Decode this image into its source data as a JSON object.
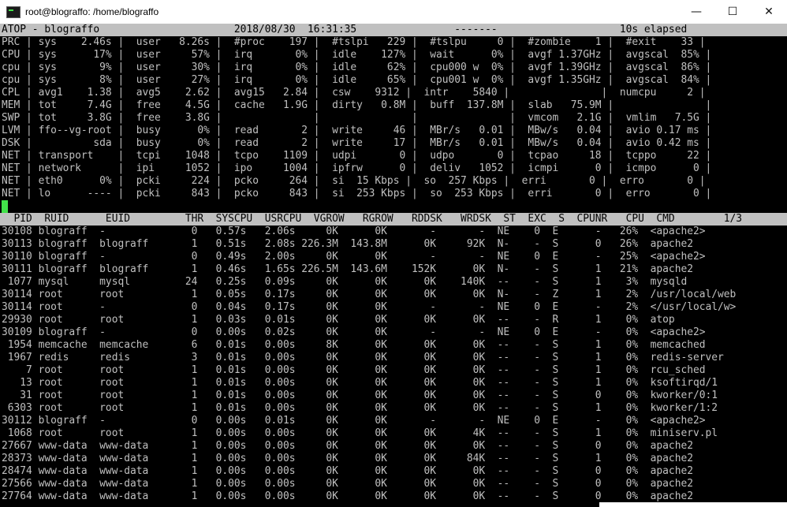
{
  "window": {
    "title": "root@blograffo: /home/blograffo",
    "minimize": "—",
    "maximize": "☐",
    "close": "✕"
  },
  "atop_header": "ATOP - blograffo                      2018/08/30  16:31:35                -------                    10s elapsed",
  "system_lines": [
    "PRC | sys    2.46s |  user   8.26s |  #proc    197 |  #tslpi   229 |  #tslpu     0 |  #zombie    1 |  #exit    33 |",
    "CPU | sys      17% |  user     57% |  irq       0% |  idle    127% |  wait      0% |  avgf 1.37GHz |  avgscal  85% |",
    "cpu | sys       9% |  user     30% |  irq       0% |  idle     62% |  cpu000 w  0% |  avgf 1.39GHz |  avgscal  86% |",
    "cpu | sys       8% |  user     27% |  irq       0% |  idle     65% |  cpu001 w  0% |  avgf 1.35GHz |  avgscal  84% |",
    "CPL | avg1    1.38 |  avg5    2.62 |  avg15   2.84 |  csw    9312 |  intr    5840 |               |  numcpu     2 |",
    "MEM | tot     7.4G |  free    4.5G |  cache   1.9G |  dirty   0.8M |  buff  137.8M |  slab   75.9M |               |",
    "SWP | tot     3.8G |  free    3.8G |               |               |               |  vmcom   2.1G |  vmlim   7.5G |",
    "LVM | ffo--vg-root |  busy      0% |  read       2 |  write     46 |  MBr/s   0.01 |  MBw/s   0.04 |  avio 0.17 ms |",
    "DSK |          sda |  busy      0% |  read       2 |  write     17 |  MBr/s   0.01 |  MBw/s   0.04 |  avio 0.42 ms |",
    "NET | transport    |  tcpi    1048 |  tcpo    1109 |  udpi       0 |  udpo       0 |  tcpao     18 |  tcppo     22 |",
    "NET | network      |  ipi     1052 |  ipo     1004 |  ipfrw      0 |  deliv   1052 |  icmpi      0 |  icmpo      0 |",
    "NET | eth0      0% |  pcki     224 |  pcko     264 |  si  15 Kbps |  so  257 Kbps |  erri       0 |  erro       0 |",
    "NET | lo      ---- |  pcki     843 |  pcko     843 |  si  253 Kbps |  so  253 Kbps |  erri       0 |  erro       0 |"
  ],
  "process_header": "  PID  RUID      EUID         THR  SYSCPU  USRCPU  VGROW   RGROW   RDDSK   WRDSK  ST  EXC  S  CPUNR   CPU  CMD        1/3",
  "process_rows": [
    "30108 blograff  -              0   0.57s   2.06s     0K      0K       -       -  NE    0  E      -   26%  <apache2>",
    "30113 blograff  blograff       1   0.51s   2.08s 226.3M  143.8M      0K     92K  N-    -  S      0   26%  apache2",
    "30110 blograff  -              0   0.49s   2.00s     0K      0K       -       -  NE    0  E      -   25%  <apache2>",
    "30111 blograff  blograff       1   0.46s   1.65s 226.5M  143.6M    152K      0K  N-    -  S      1   21%  apache2",
    " 1077 mysql     mysql         24   0.25s   0.09s     0K      0K      0K    140K  --    -  S      1    3%  mysqld",
    "30114 root      root           1   0.05s   0.17s     0K      0K      0K      0K  N-    -  Z      1    2%  /usr/local/web",
    "30114 root      -              0   0.04s   0.17s     0K      0K       -       -  NE    0  E      -    2%  </usr/local/w>",
    "29930 root      root           1   0.03s   0.01s     0K      0K      0K      0K  --    -  R      1    0%  atop",
    "30109 blograff  -              0   0.00s   0.02s     0K      0K       -       -  NE    0  E      -    0%  <apache2>",
    " 1954 memcache  memcache       6   0.01s   0.00s     8K      0K      0K      0K  --    -  S      1    0%  memcached",
    " 1967 redis     redis          3   0.01s   0.00s     0K      0K      0K      0K  --    -  S      1    0%  redis-server",
    "    7 root      root           1   0.01s   0.00s     0K      0K      0K      0K  --    -  S      1    0%  rcu_sched",
    "   13 root      root           1   0.01s   0.00s     0K      0K      0K      0K  --    -  S      1    0%  ksoftirqd/1",
    "   31 root      root           1   0.01s   0.00s     0K      0K      0K      0K  --    -  S      0    0%  kworker/0:1",
    " 6303 root      root           1   0.01s   0.00s     0K      0K      0K      0K  --    -  S      1    0%  kworker/1:2",
    "30112 blograff  -              0   0.00s   0.01s     0K      0K       -       -  NE    0  E      -    0%  <apache2>",
    " 1068 root      root           1   0.00s   0.00s     0K      0K      0K      4K  --    -  S      1    0%  miniserv.pl",
    "27667 www-data  www-data       1   0.00s   0.00s     0K      0K      0K      0K  --    -  S      0    0%  apache2",
    "28373 www-data  www-data       1   0.00s   0.00s     0K      0K      0K     84K  --    -  S      1    0%  apache2",
    "28474 www-data  www-data       1   0.00s   0.00s     0K      0K      0K      0K  --    -  S      0    0%  apache2",
    "27566 www-data  www-data       1   0.00s   0.00s     0K      0K      0K      0K  --    -  S      0    0%  apache2",
    "27764 www-data  www-data       1   0.00s   0.00s     0K      0K      0K      0K  --    -  S      0    0%  apache2"
  ],
  "colors": {
    "terminal_bg": "#000000",
    "terminal_fg": "#c0c0c0",
    "header_bar": "#c0c0c0",
    "cursor": "#42e24a"
  }
}
